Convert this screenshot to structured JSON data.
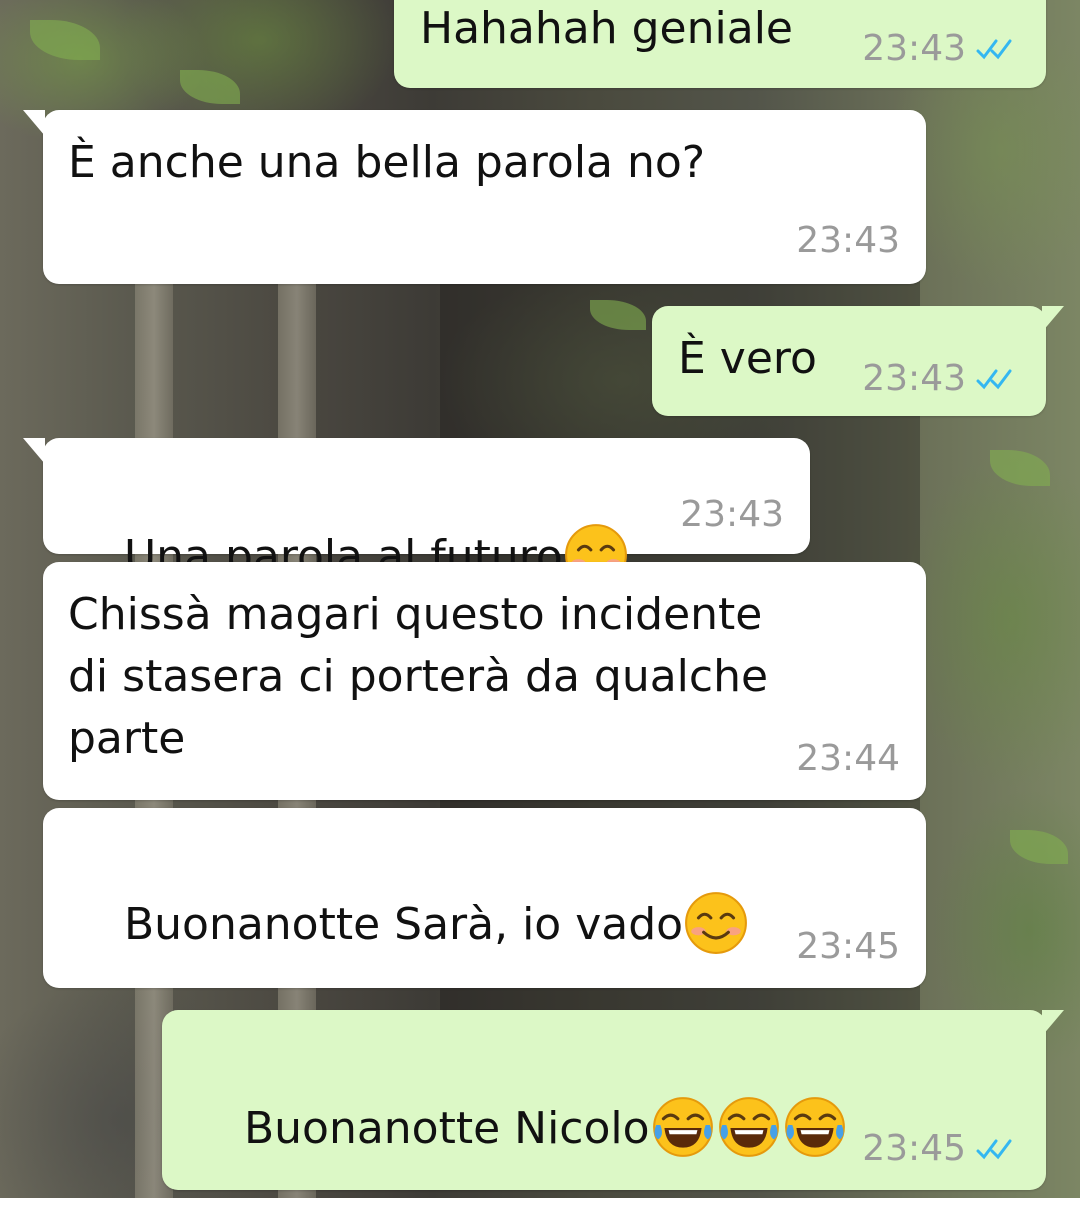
{
  "chat": {
    "messages": [
      {
        "direction": "outgoing",
        "text": "Hahahah geniale",
        "time": "23:43",
        "status": "read"
      },
      {
        "direction": "incoming",
        "text": "È anche una bella parola no?",
        "time": "23:43"
      },
      {
        "direction": "outgoing",
        "text": "È vero",
        "time": "23:43",
        "status": "read"
      },
      {
        "direction": "incoming",
        "text": "Una parola al futuro",
        "emoji": [
          "smiling-face-with-smiling-eyes"
        ],
        "time": "23:43"
      },
      {
        "direction": "incoming",
        "text": "Chissà magari questo incidente\ndi stasera ci porterà da qualche\nparte",
        "time": "23:44"
      },
      {
        "direction": "incoming",
        "text": "Buonanotte Sarà, io vado",
        "emoji": [
          "smiling-face-with-smiling-eyes"
        ],
        "time": "23:45"
      },
      {
        "direction": "outgoing",
        "text": "Buonanotte Nicolo",
        "emoji": [
          "face-with-tears-of-joy",
          "face-with-tears-of-joy",
          "face-with-tears-of-joy"
        ],
        "time": "23:45",
        "status": "read"
      }
    ]
  },
  "colors": {
    "outgoing_bubble": "#dcf8c6",
    "incoming_bubble": "#ffffff",
    "read_ticks": "#34b7f1",
    "timestamp": "#9a9a9a"
  }
}
